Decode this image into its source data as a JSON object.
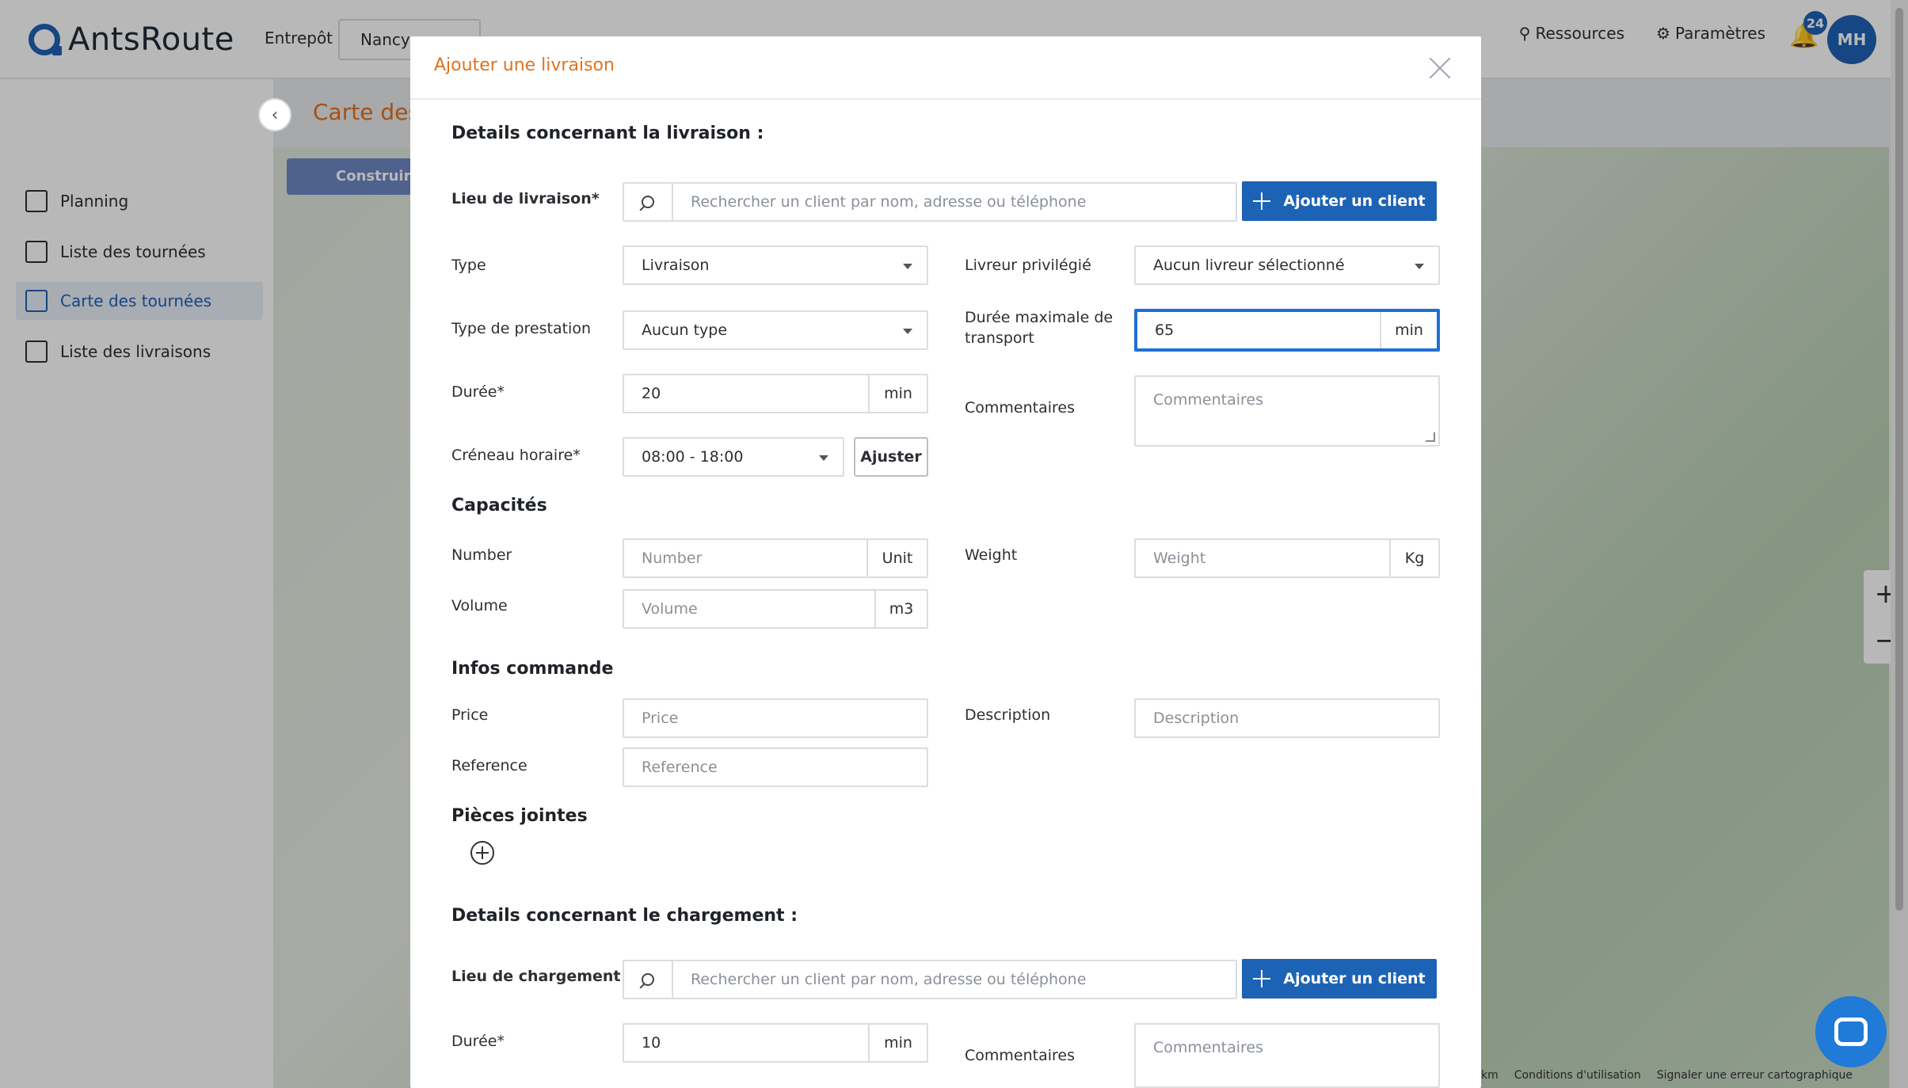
{
  "app": {
    "logo_text": "AntsRoute",
    "entrepot_label": "Entrepôt",
    "entrepot_value": "Nancy",
    "nav_right": [
      "Ressources",
      "Paramètres"
    ],
    "notif_count": "24",
    "avatar_initials": "MH"
  },
  "sidebar": {
    "items": [
      {
        "label": "Planning"
      },
      {
        "label": "Liste des tournées"
      },
      {
        "label": "Carte des tournées"
      },
      {
        "label": "Liste des livraisons"
      }
    ]
  },
  "page": {
    "title": "Carte des",
    "map_button": "Construire"
  },
  "map": {
    "footer": [
      "km",
      "Conditions d'utilisation",
      "Signaler une erreur cartographique"
    ]
  },
  "modal": {
    "title": "Ajouter une livraison",
    "delivery_section": "Details concernant la livraison :",
    "lieu_label": "Lieu de livraison*",
    "search_placeholder": "Rechercher un client par nom, adresse ou téléphone",
    "add_client": "Ajouter un client",
    "type_label": "Type",
    "type_value": "Livraison",
    "livreur_label": "Livreur privilégié",
    "livreur_value": "Aucun livreur sélectionné",
    "prestation_label": "Type de prestation",
    "prestation_value": "Aucun type",
    "duree_max_label": "Durée maximale de transport",
    "duree_max_value": "65",
    "duree_label": "Durée*",
    "duree_value": "20",
    "unit_min": "min",
    "commentaires_label": "Commentaires",
    "commentaires_placeholder": "Commentaires",
    "creneau_label": "Créneau horaire*",
    "creneau_value": "08:00 - 18:00",
    "ajuster": "Ajuster",
    "capacites_section": "Capacités",
    "number_label": "Number",
    "number_placeholder": "Number",
    "number_unit": "Unit",
    "weight_label": "Weight",
    "weight_placeholder": "Weight",
    "weight_unit": "Kg",
    "volume_label": "Volume",
    "volume_placeholder": "Volume",
    "volume_unit": "m3",
    "infos_section": "Infos commande",
    "price_label": "Price",
    "price_placeholder": "Price",
    "description_label": "Description",
    "description_placeholder": "Description",
    "reference_label": "Reference",
    "reference_placeholder": "Reference",
    "pieces_section": "Pièces jointes",
    "loading_section": "Details concernant le chargement :",
    "chargement_label": "Lieu de chargement *",
    "loading_duree_value": "10"
  }
}
